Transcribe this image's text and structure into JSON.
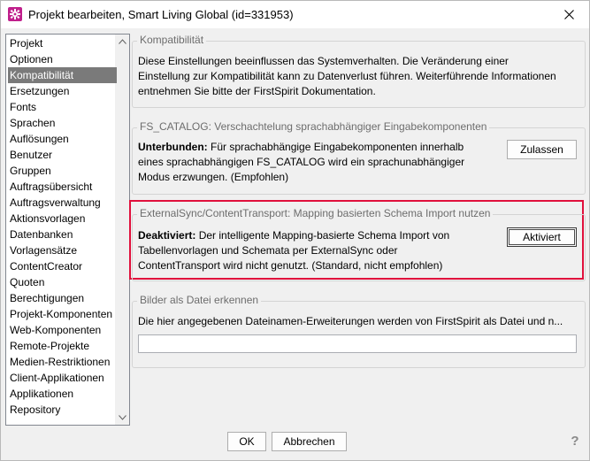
{
  "window": {
    "title": "Projekt bearbeiten, Smart Living Global (id=331953)",
    "icon": "gear-icon",
    "accent_color": "#c0208c"
  },
  "sidebar": {
    "items": [
      {
        "label": "Projekt"
      },
      {
        "label": "Optionen"
      },
      {
        "label": "Kompatibilität",
        "selected": true
      },
      {
        "label": "Ersetzungen"
      },
      {
        "label": "Fonts"
      },
      {
        "label": "Sprachen"
      },
      {
        "label": "Auflösungen"
      },
      {
        "label": "Benutzer"
      },
      {
        "label": "Gruppen"
      },
      {
        "label": "Auftragsübersicht"
      },
      {
        "label": "Auftragsverwaltung"
      },
      {
        "label": "Aktionsvorlagen"
      },
      {
        "label": "Datenbanken"
      },
      {
        "label": "Vorlagensätze"
      },
      {
        "label": "ContentCreator"
      },
      {
        "label": "Quoten"
      },
      {
        "label": "Berechtigungen"
      },
      {
        "label": "Projekt-Komponenten"
      },
      {
        "label": "Web-Komponenten"
      },
      {
        "label": "Remote-Projekte"
      },
      {
        "label": "Medien-Restriktionen"
      },
      {
        "label": "Client-Applikationen"
      },
      {
        "label": "Applikationen"
      },
      {
        "label": "Repository"
      }
    ]
  },
  "main": {
    "kompat": {
      "legend": "Kompatibilität",
      "lines": [
        "Diese Einstellungen beeinflussen das Systemverhalten. Die Veränderung einer",
        "Einstellung zur Kompatibilität kann zu Datenverlust führen. Weiterführende Informationen",
        "entnehmen Sie bitte der FirstSpirit Dokumentation."
      ]
    },
    "fs_catalog": {
      "legend": "FS_CATALOG: Verschachtelung sprachabhängiger Eingabekomponenten",
      "bold": "Unterbunden:",
      "lines": [
        " Für sprachabhängige Eingabekomponenten innerhalb",
        "eines sprachabhängigen FS_CATALOG wird ein sprachunabhängiger",
        "Modus erzwungen. (Empfohlen)"
      ],
      "button": "Zulassen"
    },
    "external_sync": {
      "legend": "ExternalSync/ContentTransport: Mapping basierten Schema Import nutzen",
      "bold": "Deaktiviert:",
      "lines": [
        " Der intelligente Mapping-basierte Schema Import von",
        "Tabellenvorlagen und Schemata per ExternalSync oder",
        "ContentTransport wird nicht genutzt. (Standard, nicht empfohlen)"
      ],
      "button": "Aktiviert",
      "highlight_color": "#e0103c"
    },
    "bilder": {
      "legend": "Bilder als Datei erkennen",
      "text": "Die hier angegebenen Dateinamen-Erweiterungen werden von FirstSpirit als Datei und n...",
      "input_value": ""
    }
  },
  "footer": {
    "ok": "OK",
    "cancel": "Abbrechen",
    "help": "?"
  }
}
